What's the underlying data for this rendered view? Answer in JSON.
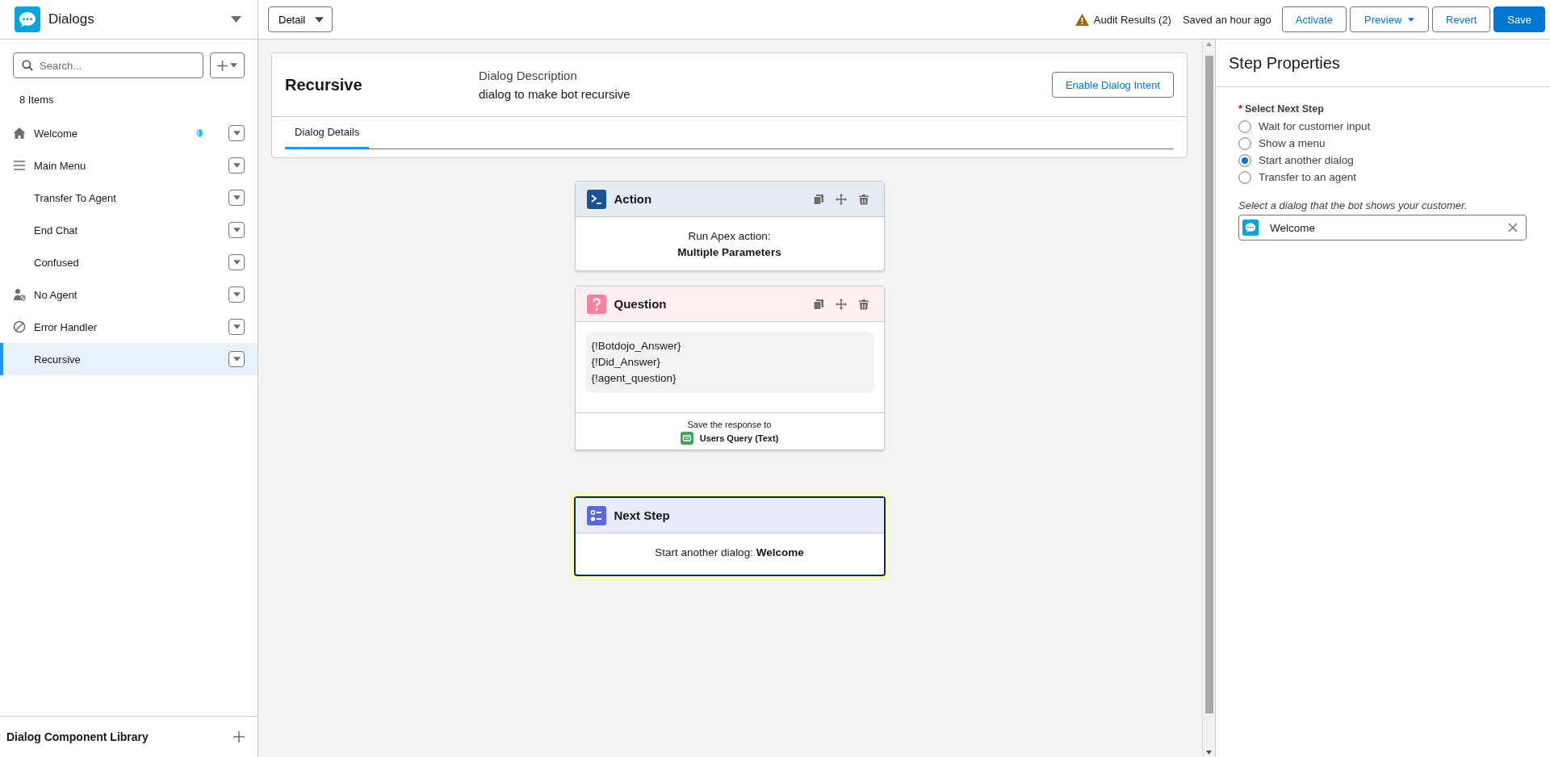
{
  "app": {
    "title": "Dialogs"
  },
  "view_select": {
    "value": "Detail"
  },
  "toolbar": {
    "audit": "Audit Results (2)",
    "saved": "Saved an hour ago",
    "buttons": [
      {
        "label": "Activate",
        "kind": "neutral"
      },
      {
        "label": "Preview",
        "kind": "menu"
      },
      {
        "label": "Revert",
        "kind": "neutral"
      },
      {
        "label": "Save",
        "kind": "brand"
      }
    ]
  },
  "sidebar": {
    "search": {
      "placeholder": "Search..."
    },
    "count": "8 Items",
    "items": [
      {
        "label": "Welcome",
        "kind": "home",
        "start_marker": true,
        "selected": false
      },
      {
        "label": "Main Menu",
        "kind": "menu",
        "start_marker": false,
        "selected": false
      },
      {
        "label": "Transfer To Agent",
        "kind": "plain",
        "start_marker": false,
        "selected": false
      },
      {
        "label": "End Chat",
        "kind": "plain",
        "start_marker": false,
        "selected": false
      },
      {
        "label": "Confused",
        "kind": "plain",
        "start_marker": false,
        "selected": false
      },
      {
        "label": "No Agent",
        "kind": "agent",
        "start_marker": false,
        "selected": false
      },
      {
        "label": "Error Handler",
        "kind": "error",
        "start_marker": false,
        "selected": false
      },
      {
        "label": "Recursive",
        "kind": "plain",
        "start_marker": false,
        "selected": true
      }
    ],
    "library": "Dialog Component Library"
  },
  "dialog": {
    "name": "Recursive",
    "description_label": "Dialog Description",
    "description": "dialog to make bot recursive",
    "intent_button": "Enable Dialog Intent",
    "tabs": [
      {
        "label": "Dialog Details",
        "selected": true
      }
    ]
  },
  "steps": [
    {
      "kind": "action",
      "title": "Action",
      "lines": [
        "Run Apex action:",
        "Multiple Parameters"
      ]
    },
    {
      "kind": "question",
      "title": "Question",
      "lines": [
        "{!Botdojo_Answer}",
        "{!Did_Answer}",
        "{!agent_question}"
      ],
      "save_label": "Save the response to",
      "variable": "Users Query (Text)"
    },
    {
      "kind": "next_step",
      "title": "Next Step",
      "text": "Start another dialog: **Welcome**",
      "highlighted": true
    }
  ],
  "properties": {
    "title": "Step Properties",
    "required_mark": "*",
    "group_label": "Select Next Step",
    "options": [
      {
        "label": "Wait for customer input",
        "selected": false
      },
      {
        "label": "Show a menu",
        "selected": false
      },
      {
        "label": "Start another dialog",
        "selected": true
      },
      {
        "label": "Transfer to an agent",
        "selected": false
      }
    ],
    "hint": "Select a dialog that the bot shows your customer.",
    "lookup": {
      "value": "Welcome"
    }
  }
}
